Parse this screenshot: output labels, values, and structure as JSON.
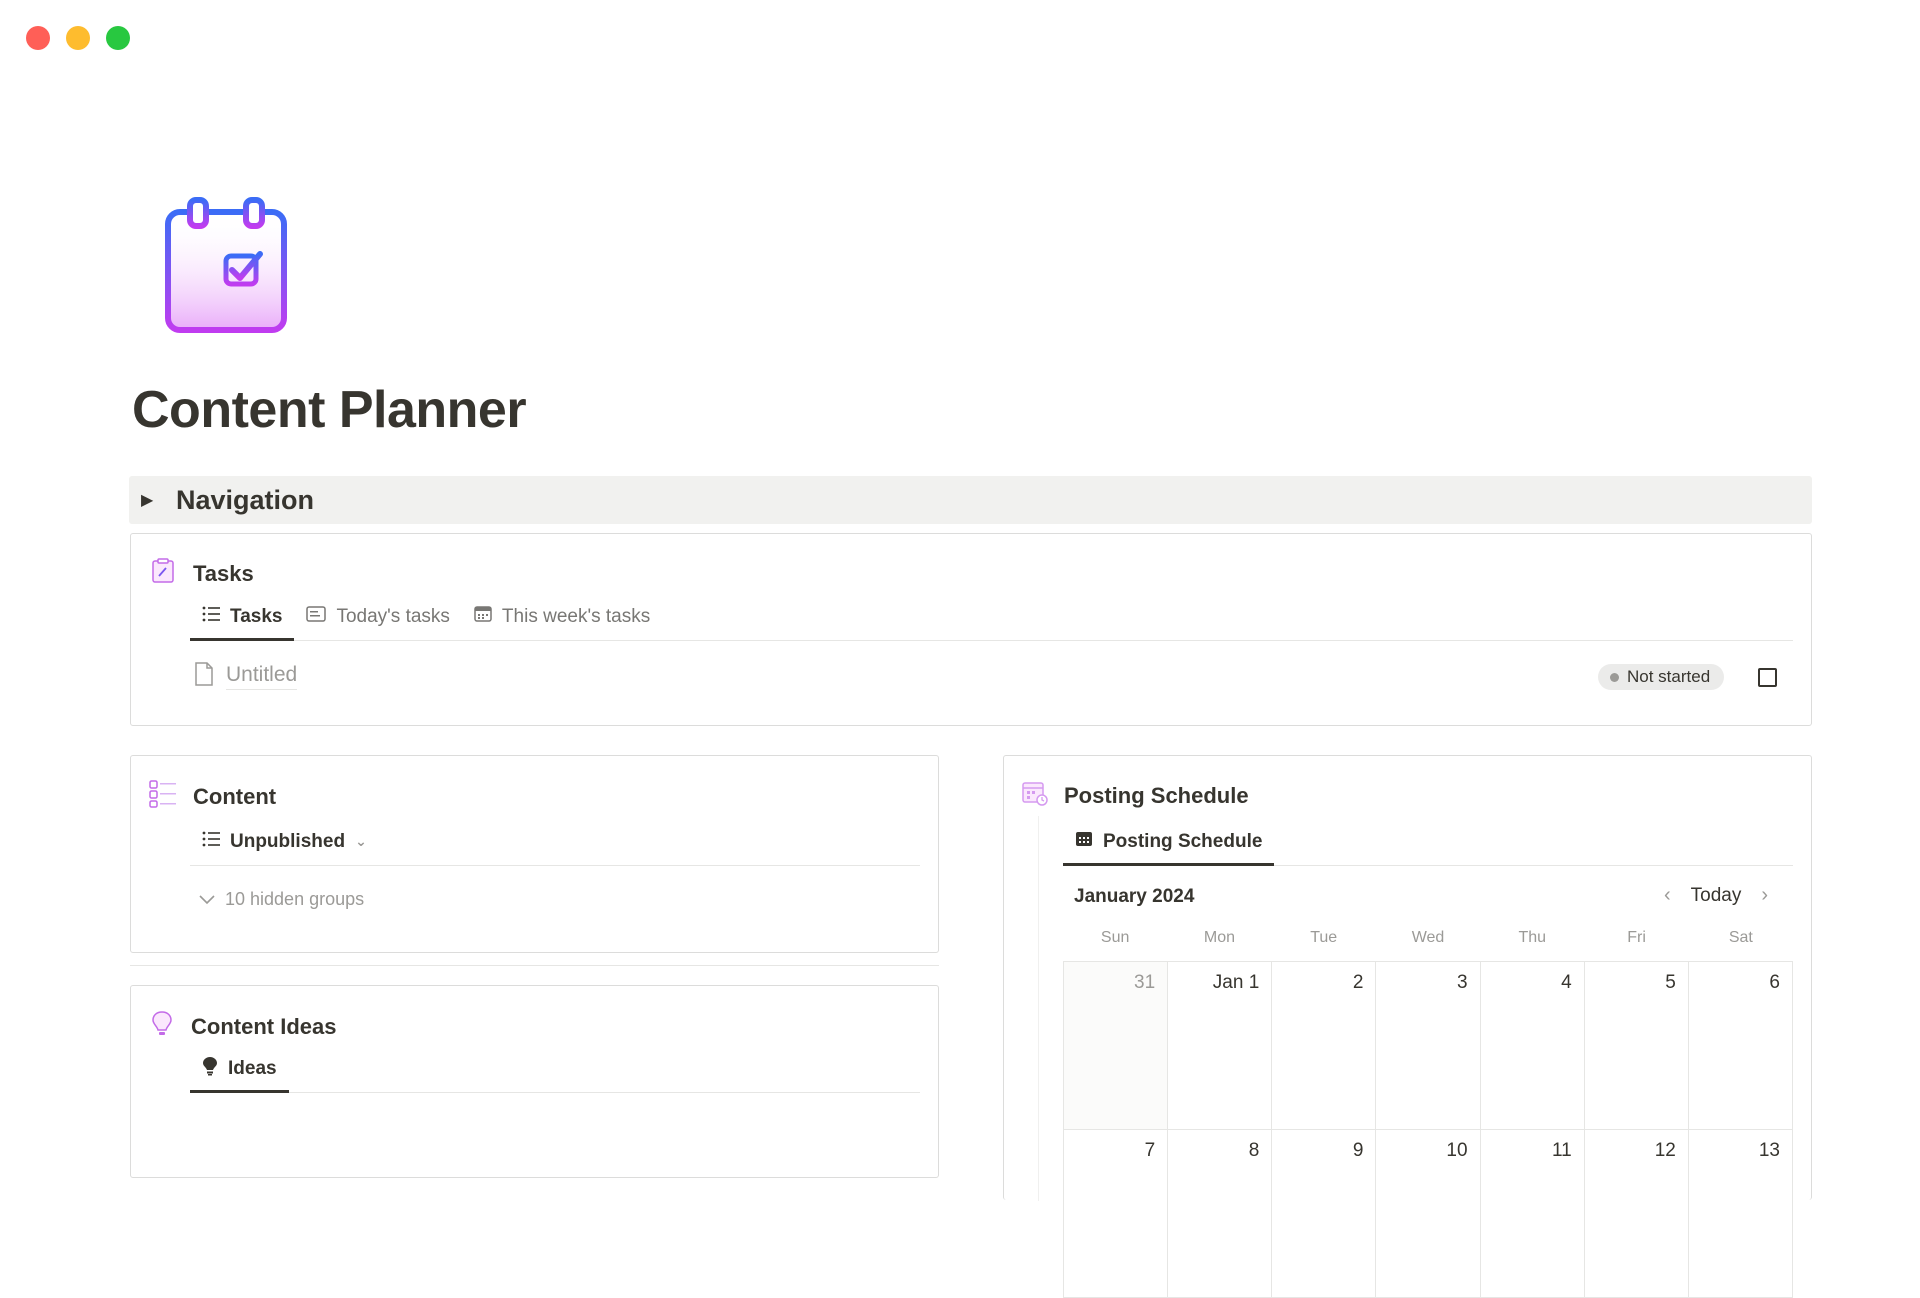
{
  "window": {
    "colors": {
      "close": "#ff5f57",
      "minimize": "#febc2e",
      "zoom": "#28c840"
    }
  },
  "page": {
    "title": "Content Planner",
    "icon": "calendar-check-icon"
  },
  "navigation": {
    "label": "Navigation"
  },
  "tasks": {
    "title": "Tasks",
    "tabs": [
      {
        "label": "Tasks",
        "icon": "list-icon",
        "active": true
      },
      {
        "label": "Today's tasks",
        "icon": "board-icon",
        "active": false
      },
      {
        "label": "This week's tasks",
        "icon": "calendar-icon",
        "active": false
      }
    ],
    "rows": [
      {
        "title": "Untitled",
        "status": "Not started",
        "done": false
      }
    ]
  },
  "content": {
    "title": "Content",
    "view": {
      "label": "Unpublished",
      "icon": "list-icon"
    },
    "hidden_groups": "10 hidden groups"
  },
  "content_ideas": {
    "title": "Content Ideas",
    "tabs": [
      {
        "label": "Ideas",
        "icon": "lightbulb-icon",
        "active": true
      }
    ]
  },
  "posting_schedule": {
    "title": "Posting Schedule",
    "tabs": [
      {
        "label": "Posting Schedule",
        "icon": "calendar-icon",
        "active": true
      }
    ],
    "month": "January 2024",
    "today_label": "Today",
    "weekdays": [
      "Sun",
      "Mon",
      "Tue",
      "Wed",
      "Thu",
      "Fri",
      "Sat"
    ],
    "days": [
      {
        "label": "31",
        "muted": true
      },
      {
        "label": "Jan 1",
        "muted": false
      },
      {
        "label": "2",
        "muted": false
      },
      {
        "label": "3",
        "muted": false
      },
      {
        "label": "4",
        "muted": false
      },
      {
        "label": "5",
        "muted": false
      },
      {
        "label": "6",
        "muted": false
      },
      {
        "label": "7",
        "muted": false
      },
      {
        "label": "8",
        "muted": false
      },
      {
        "label": "9",
        "muted": false
      },
      {
        "label": "10",
        "muted": false
      },
      {
        "label": "11",
        "muted": false
      },
      {
        "label": "12",
        "muted": false
      },
      {
        "label": "13",
        "muted": false
      }
    ]
  },
  "colors": {
    "accent_gradient_start": "#3b6cf6",
    "accent_gradient_end": "#c03cf0",
    "text": "#37352f",
    "muted": "#9b9a97"
  }
}
